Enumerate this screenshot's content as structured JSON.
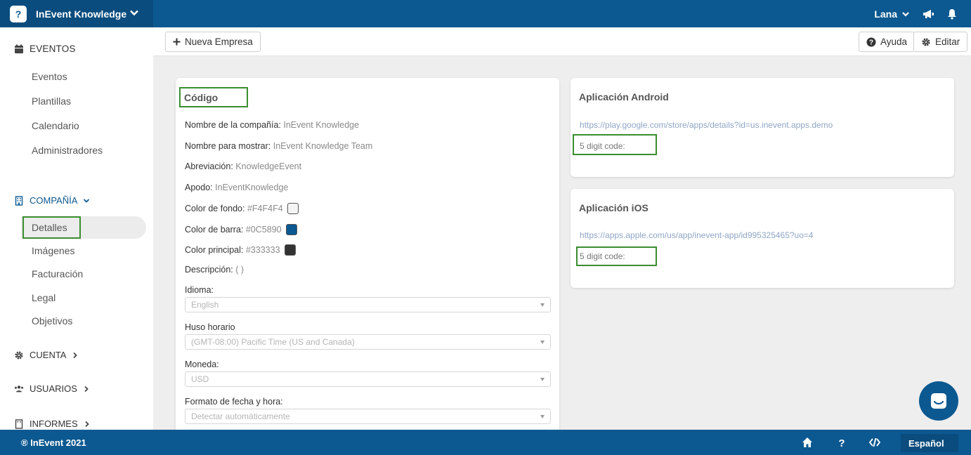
{
  "header": {
    "app_name": "InEvent Knowledge",
    "logo_glyph": "?",
    "user_name": "Lana",
    "accent": "#0c5890"
  },
  "sidebar": {
    "eventos_title": "EVENTOS",
    "eventos_items": [
      "Eventos",
      "Plantillas",
      "Calendario",
      "Administradores"
    ],
    "compania_title": "COMPAÑÍA",
    "compania_items": [
      "Detalles",
      "Imágenes",
      "Facturación",
      "Legal",
      "Objetivos"
    ],
    "cuenta_title": "CUENTA",
    "usuarios_title": "USUARIOS",
    "informes_title": "INFORMES"
  },
  "toolbar": {
    "new_company_label": "Nueva Empresa",
    "help_label": "Ayuda",
    "edit_label": "Editar"
  },
  "details": {
    "title": "Código",
    "fields": [
      {
        "label": "Nombre de la compañía:",
        "value": "InEvent Knowledge"
      },
      {
        "label": "Nombre para mostrar:",
        "value": "InEvent Knowledge Team"
      },
      {
        "label": "Abreviación:",
        "value": "KnowledgeEvent"
      },
      {
        "label": "Apodo:",
        "value": "InEventKnowledge"
      },
      {
        "label": "Color de fondo:",
        "value": "#F4F4F4"
      },
      {
        "label": "Color de barra:",
        "value": "#0C5890"
      },
      {
        "label": "Color principal:",
        "value": "#333333"
      },
      {
        "label": "Descripción:",
        "value": "( )"
      }
    ],
    "selects": [
      {
        "label": "Idioma:",
        "value": "English"
      },
      {
        "label": "Huso horario",
        "value": "(GMT-08:00) Pacific Time (US and Canada)"
      },
      {
        "label": "Moneda:",
        "value": "USD"
      },
      {
        "label": "Formato de fecha y hora:",
        "value": "Detectar automáticamente"
      }
    ]
  },
  "android": {
    "title": "Aplicación Android",
    "link": "https://play.google.com/store/apps/details?id=us.inevent.apps.demo",
    "code_label": "5 digit code:"
  },
  "ios": {
    "title": "Aplicación iOS",
    "link": "https://apps.apple.com/us/app/inevent-app/id995325465?uo=4",
    "code_label": "5 digit code:"
  },
  "footer": {
    "copyright": "® InEvent 2021",
    "language": "Español"
  }
}
